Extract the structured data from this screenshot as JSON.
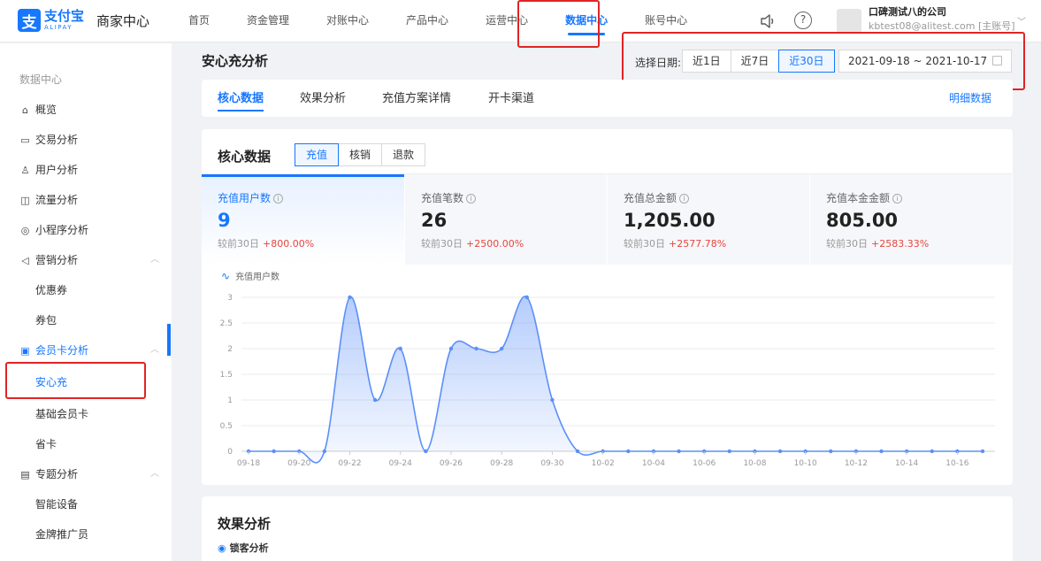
{
  "brand": {
    "logo_glyph": "支",
    "name": "支付宝",
    "name_en": "ALIPAY",
    "merchant": "商家中心"
  },
  "nav": [
    "首页",
    "资金管理",
    "对账中心",
    "产品中心",
    "运营中心",
    "数据中心",
    "账号中心"
  ],
  "nav_active": "数据中心",
  "account": {
    "company": "口碑测试八的公司",
    "email": "kbtest08@alitest.com [主账号]"
  },
  "sidebar": {
    "title": "数据中心",
    "items": [
      {
        "label": "概览",
        "icon": "home-icon"
      },
      {
        "label": "交易分析",
        "icon": "monitor-icon"
      },
      {
        "label": "用户分析",
        "icon": "user-icon"
      },
      {
        "label": "流量分析",
        "icon": "chart-icon"
      },
      {
        "label": "小程序分析",
        "icon": "miniapp-icon"
      },
      {
        "label": "营销分析",
        "icon": "megaphone-icon"
      },
      {
        "label": "优惠券"
      },
      {
        "label": "券包"
      },
      {
        "label": "会员卡分析",
        "icon": "card-icon"
      },
      {
        "label": "安心充"
      },
      {
        "label": "基础会员卡"
      },
      {
        "label": "省卡"
      },
      {
        "label": "专题分析",
        "icon": "book-icon"
      },
      {
        "label": "智能设备"
      },
      {
        "label": "金牌推广员"
      }
    ],
    "selected": "安心充"
  },
  "page": {
    "title": "安心充分析"
  },
  "date_filter": {
    "label": "选择日期:",
    "options": [
      "近1日",
      "近7日",
      "近30日"
    ],
    "selected": "近30日",
    "range": "2021-09-18 ~ 2021-10-17"
  },
  "tabs": [
    "核心数据",
    "效果分析",
    "充值方案详情",
    "开卡渠道"
  ],
  "tab_active": "核心数据",
  "detail_link": "明细数据",
  "core": {
    "title": "核心数据",
    "segments": [
      "充值",
      "核销",
      "退款"
    ],
    "segment_active": "充值",
    "metrics": [
      {
        "label": "充值用户数",
        "value": "9",
        "compare_label": "较前30日",
        "compare_value": "+800.00%"
      },
      {
        "label": "充值笔数",
        "value": "26",
        "compare_label": "较前30日",
        "compare_value": "+2500.00%"
      },
      {
        "label": "充值总金额",
        "value": "1,205.00",
        "compare_label": "较前30日",
        "compare_value": "+2577.78%"
      },
      {
        "label": "充值本金金额",
        "value": "805.00",
        "compare_label": "较前30日",
        "compare_value": "+2583.33%"
      }
    ]
  },
  "chart_data": {
    "type": "area",
    "series": [
      {
        "name": "充值用户数",
        "x": [
          "09-18",
          "09-19",
          "09-20",
          "09-21",
          "09-22",
          "09-23",
          "09-24",
          "09-25",
          "09-26",
          "09-27",
          "09-28",
          "09-29",
          "09-30",
          "10-01",
          "10-02",
          "10-03",
          "10-04",
          "10-05",
          "10-06",
          "10-07",
          "10-08",
          "10-09",
          "10-10",
          "10-11",
          "10-12",
          "10-13",
          "10-14",
          "10-15",
          "10-16",
          "10-17"
        ],
        "values": [
          0,
          0,
          0,
          0,
          3,
          1,
          2,
          0,
          2,
          2,
          2,
          3,
          1,
          0,
          0,
          0,
          0,
          0,
          0,
          0,
          0,
          0,
          0,
          0,
          0,
          0,
          0,
          0,
          0,
          0
        ]
      }
    ],
    "x_tick_labels": [
      "09-18",
      "09-20",
      "09-22",
      "09-24",
      "09-26",
      "09-28",
      "09-30",
      "10-02",
      "10-04",
      "10-06",
      "10-08",
      "10-10",
      "10-12",
      "10-14",
      "10-16"
    ],
    "y_ticks": [
      0,
      0.5,
      1,
      1.5,
      2,
      2.5,
      3
    ],
    "ylim": [
      0,
      3
    ],
    "grid": true,
    "color": "#5b8ff9"
  },
  "effect": {
    "title": "效果分析",
    "sub": "锁客分析"
  }
}
